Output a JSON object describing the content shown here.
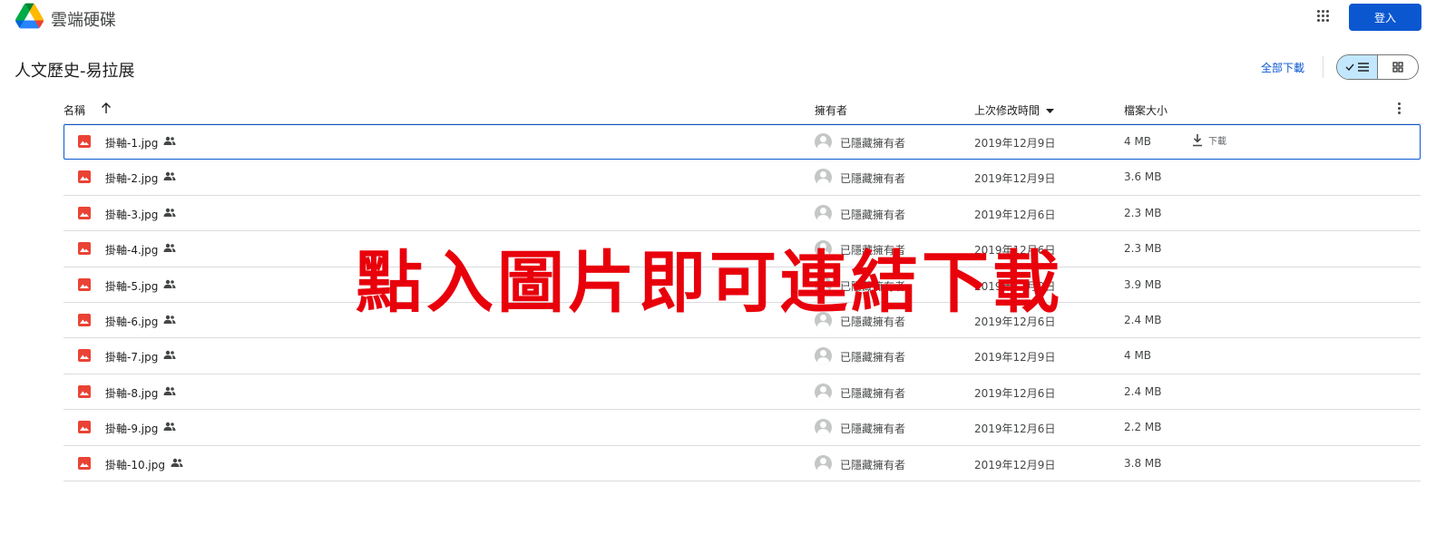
{
  "app": {
    "title": "雲端硬碟",
    "signin_label": "登入"
  },
  "folder": {
    "title": "人文歷史-易拉展",
    "download_all_label": "全部下載"
  },
  "columns": {
    "name": "名稱",
    "owner": "擁有者",
    "modified": "上次修改時間",
    "size": "檔案大小"
  },
  "overlay_text": "點入圖片即可連結下載",
  "row_download_label": "下載",
  "colors": {
    "accent": "#0b57d0",
    "image_icon": "#ea4335",
    "overlay": "#e8000b"
  },
  "files": [
    {
      "name": "掛軸-1.jpg",
      "owner": "已隱藏擁有者",
      "modified": "2019年12月9日",
      "size": "4 MB",
      "selected": true
    },
    {
      "name": "掛軸-2.jpg",
      "owner": "已隱藏擁有者",
      "modified": "2019年12月9日",
      "size": "3.6 MB"
    },
    {
      "name": "掛軸-3.jpg",
      "owner": "已隱藏擁有者",
      "modified": "2019年12月6日",
      "size": "2.3 MB"
    },
    {
      "name": "掛軸-4.jpg",
      "owner": "已隱藏擁有者",
      "modified": "2019年12月6日",
      "size": "2.3 MB"
    },
    {
      "name": "掛軸-5.jpg",
      "owner": "已隱藏擁有者",
      "modified": "2019年12月9日",
      "size": "3.9 MB"
    },
    {
      "name": "掛軸-6.jpg",
      "owner": "已隱藏擁有者",
      "modified": "2019年12月6日",
      "size": "2.4 MB"
    },
    {
      "name": "掛軸-7.jpg",
      "owner": "已隱藏擁有者",
      "modified": "2019年12月9日",
      "size": "4 MB"
    },
    {
      "name": "掛軸-8.jpg",
      "owner": "已隱藏擁有者",
      "modified": "2019年12月6日",
      "size": "2.4 MB"
    },
    {
      "name": "掛軸-9.jpg",
      "owner": "已隱藏擁有者",
      "modified": "2019年12月6日",
      "size": "2.2 MB"
    },
    {
      "name": "掛軸-10.jpg",
      "owner": "已隱藏擁有者",
      "modified": "2019年12月9日",
      "size": "3.8 MB"
    }
  ]
}
